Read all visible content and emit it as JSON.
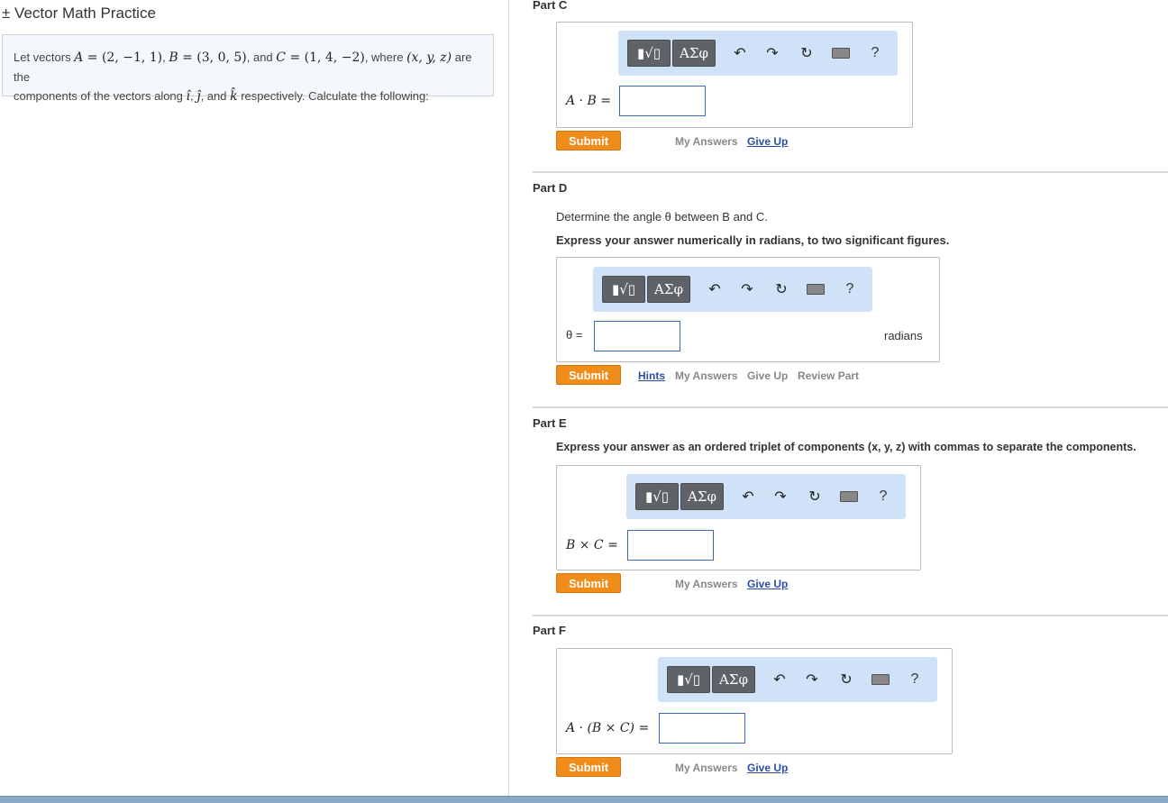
{
  "left": {
    "title": "± Vector Math Practice",
    "problem": {
      "intro": "Let vectors ",
      "A_name": "A",
      "A_val": " = (2, −1, 1)",
      "B_name": "B",
      "B_val": " = (3, 0, 5)",
      "and": ", and ",
      "C_name": "C",
      "C_val": " = (1, 4, −2)",
      "where": ", where ",
      "xyz": "(x, y, z)",
      "are_the": " are the",
      "line2a": "components of the vectors along ",
      "i": "î",
      "comma": ", ",
      "j": "ĵ",
      "and2": ", and ",
      "k": "k̂",
      "line2b": " respectively. Calculate the following:"
    }
  },
  "toolbar": {
    "templates_label": "▮√▯",
    "greek_label": "ΑΣφ",
    "help_label": "?"
  },
  "partC": {
    "title": "Part C",
    "label": "A · B =",
    "submit": "Submit",
    "my_answers": "My Answers",
    "give_up": "Give Up"
  },
  "partD": {
    "title": "Part D",
    "prompt": "Determine the angle θ between B and C.",
    "instruction": "Express your answer numerically in radians, to two significant figures.",
    "label": "θ =",
    "unit": "radians",
    "submit": "Submit",
    "hints": "Hints",
    "my_answers": "My Answers",
    "give_up": "Give Up",
    "review": "Review Part"
  },
  "partE": {
    "title": "Part E",
    "instruction": "Express your answer as an ordered triplet of components (x, y, z) with commas to separate the components.",
    "label": "B × C =",
    "submit": "Submit",
    "my_answers": "My Answers",
    "give_up": "Give Up"
  },
  "partF": {
    "title": "Part F",
    "label": "A · (B × C) =",
    "submit": "Submit",
    "my_answers": "My Answers",
    "give_up": "Give Up"
  },
  "colors": {
    "submit": "#ef8c1a",
    "toolbar": "#cfe2f7",
    "link": "#2b4fa0"
  }
}
